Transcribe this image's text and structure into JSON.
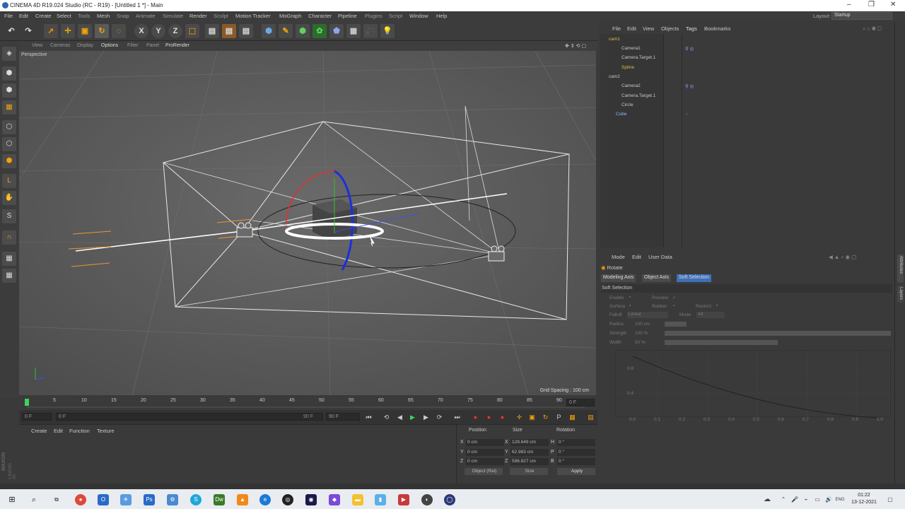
{
  "window": {
    "title": "CINEMA 4D R19.024 Studio (RC - R19) - [Untitled 1 *] - Main",
    "minimize": "–",
    "maximize": "❐",
    "close": "✕"
  },
  "menu": [
    "File",
    "Edit",
    "Create",
    "Select",
    "Tools",
    "Mesh",
    "Snap",
    "Animate",
    "Simulate",
    "Render",
    "Sculpt",
    "Motion Tracker",
    "MoGraph",
    "Character",
    "Pipeline",
    "Plugins",
    "Script",
    "Window",
    "Help"
  ],
  "layout": {
    "label": "Layout:",
    "value": "Startup"
  },
  "toolbar": {
    "x": "X",
    "y": "Y",
    "z": "Z"
  },
  "viewport": {
    "menu": [
      "View",
      "Cameras",
      "Display",
      "Options",
      "Filter",
      "Panel",
      "ProRender"
    ],
    "label": "Perspective",
    "grid_spacing": "Grid Spacing : 100 cm"
  },
  "timeline": {
    "ticks": [
      "0",
      "5",
      "10",
      "15",
      "20",
      "25",
      "30",
      "35",
      "40",
      "45",
      "50",
      "55",
      "60",
      "65",
      "70",
      "75",
      "80",
      "85",
      "90"
    ],
    "end_frame": "0 F",
    "start": "0 F",
    "range_start": "0 F",
    "range_end": "90 F",
    "max": "90 F"
  },
  "material": {
    "menu": [
      "Create",
      "Edit",
      "Function",
      "Texture"
    ]
  },
  "coords": {
    "headers": [
      "Position",
      "Size",
      "Rotation"
    ],
    "rows": [
      {
        "axis": "X",
        "pos": "0 cm",
        "size": "129.649 cm",
        "rlabel": "H",
        "rot": "0 °"
      },
      {
        "axis": "Y",
        "pos": "0 cm",
        "size": "62.983 cm",
        "rlabel": "P",
        "rot": "0 °"
      },
      {
        "axis": "Z",
        "pos": "0 cm",
        "size": "596.827 cm",
        "rlabel": "B",
        "rot": "0 °"
      }
    ],
    "mode": "Object (Rel)",
    "size_mode": "Size",
    "apply": "Apply"
  },
  "maxon": {
    "brand": "MAXON",
    "product": "CINEMA 4D"
  },
  "objects": {
    "menu": [
      "File",
      "Edit",
      "View",
      "Objects",
      "Tags",
      "Bookmarks"
    ],
    "items": [
      {
        "name": "cam1"
      },
      {
        "name": "Camera1"
      },
      {
        "name": "Camera.Target.1"
      },
      {
        "name": "Spline"
      },
      {
        "name": "cam2"
      },
      {
        "name": "Camera2"
      },
      {
        "name": "Camera.Target.1"
      },
      {
        "name": "Circle"
      },
      {
        "name": "Cube"
      }
    ]
  },
  "attributes": {
    "menu": [
      "Mode",
      "Edit",
      "User Data"
    ],
    "tool": "Rotate",
    "tabs": [
      "Modeling Axis",
      "Object Axis",
      "Soft Selection"
    ],
    "section": "Soft Selection",
    "fields": {
      "enable": "Enable",
      "preview": "Preview",
      "surface": "Surface",
      "rubber": "Rubber",
      "restrict": "Restrict",
      "falloff": "Falloff",
      "falloff_val": "Linear",
      "mode": "Mode",
      "mode_val": "All",
      "radius": "Radius",
      "radius_val": "100 cm",
      "strength": "Strength",
      "strength_val": "100 %",
      "width": "Width",
      "width_val": "50 %"
    },
    "graph": {
      "y_ticks": [
        "0.8",
        "0.4"
      ],
      "x_ticks": [
        "0.0",
        "0.1",
        "0.2",
        "0.3",
        "0.4",
        "0.5",
        "0.6",
        "0.7",
        "0.8",
        "0.9",
        "1.0"
      ]
    }
  },
  "side_tabs": [
    "Attributes",
    "Layers"
  ],
  "taskbar": {
    "time": "01:22",
    "date": "13-12-2021"
  }
}
